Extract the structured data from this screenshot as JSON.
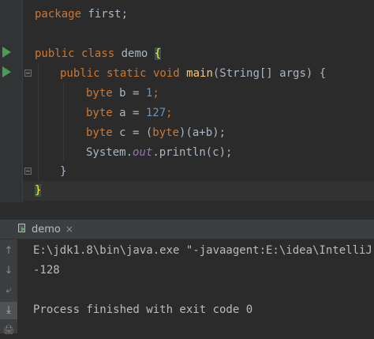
{
  "editor": {
    "code": {
      "l1": {
        "kw": "package",
        "rest": " first;"
      },
      "l3": {
        "kw": "public class",
        "rest": " demo ",
        "brace": "{"
      },
      "l4": {
        "kw": "public static void",
        "fn": "main",
        "rest": "(String[] args) {"
      },
      "l5": {
        "kw": "byte",
        "pre": " b = ",
        "num": "1",
        "post": ";"
      },
      "l6": {
        "kw": "byte",
        "pre": " a = ",
        "num": "127",
        "post": ";"
      },
      "l7": {
        "kw": "byte",
        "pre": " c = (",
        "kw2": "byte",
        "post": ")(a+b);"
      },
      "l8": {
        "pre": "System.",
        "it": "out",
        "post": ".println(c);"
      },
      "l9": {
        "text": "}"
      },
      "l10": {
        "brace": "}"
      }
    }
  },
  "run_panel": {
    "tab_label": "demo",
    "tab_close": "×",
    "console": [
      "E:\\jdk1.8\\bin\\java.exe \"-javaagent:E:\\idea\\IntelliJ ID",
      "-128",
      "",
      "Process finished with exit code 0"
    ],
    "tools": [
      "↑",
      "↓",
      "⤶",
      "⤓",
      "🖨",
      "🗑"
    ]
  },
  "colors": {
    "keyword": "#cc7832",
    "number": "#6897bb",
    "function": "#ffc66d",
    "field": "#9876aa",
    "run": "#499c54"
  }
}
